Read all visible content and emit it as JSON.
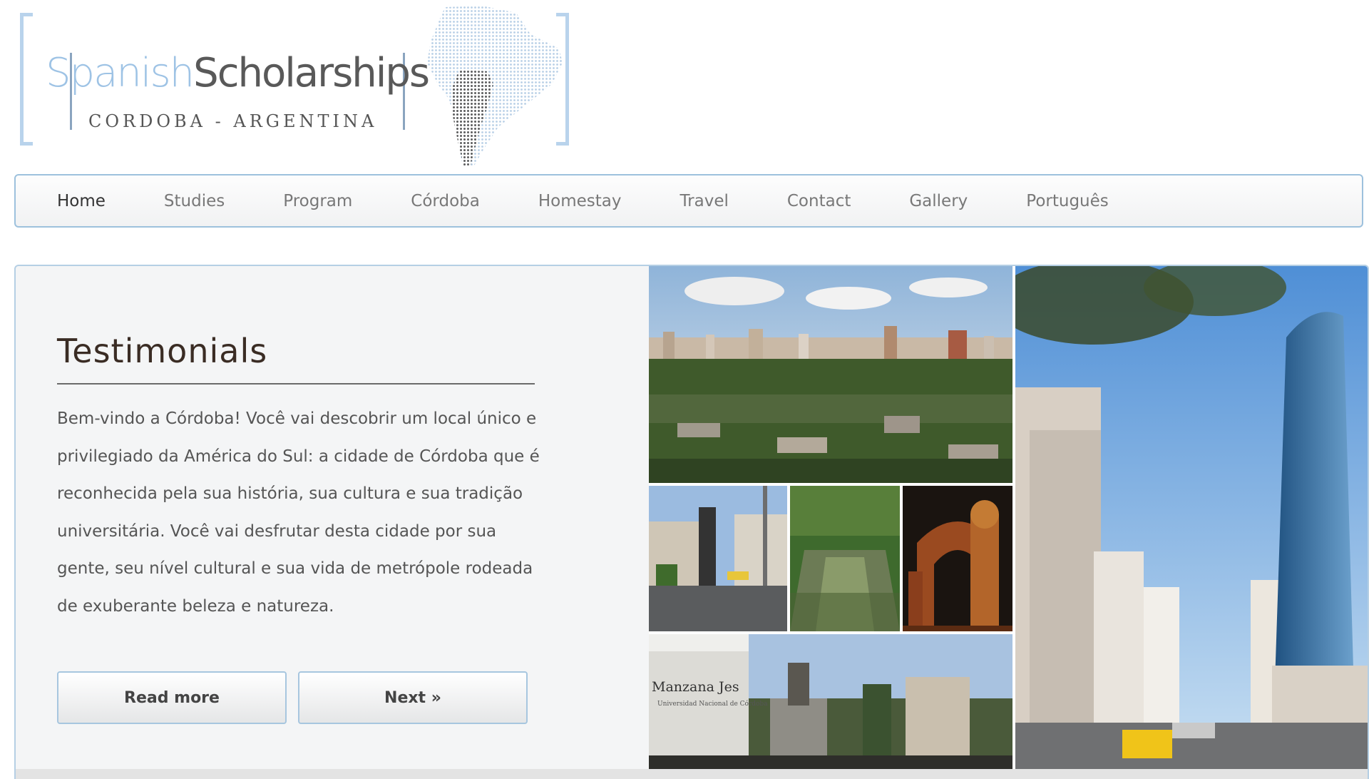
{
  "header": {
    "logo": {
      "title_part1": "Spanish",
      "title_part2": "Scholarships",
      "subtitle": "CORDOBA - ARGENTINA",
      "icon": "south-america-map"
    }
  },
  "nav": {
    "items": [
      {
        "label": "Home",
        "active": true
      },
      {
        "label": "Studies"
      },
      {
        "label": "Program"
      },
      {
        "label": "Córdoba"
      },
      {
        "label": "Homestay"
      },
      {
        "label": "Travel"
      },
      {
        "label": "Contact"
      },
      {
        "label": "Gallery"
      },
      {
        "label": "Português"
      }
    ]
  },
  "main": {
    "title": "Testimonials",
    "body": "Bem-vindo a Córdoba! Você vai descobrir um local único e privilegiado da América do Sul: a cidade de Córdoba que é reconhecida pela sua história, sua cultura e sua tradição universitária. Você vai desfrutar desta cidade por sua gente, seu nível cultural e sua vida de metrópole rodeada de exuberante beleza e natureza.",
    "read_more_label": "Read more",
    "next_label": "Next »"
  },
  "collage": {
    "sign_text_1": "Manzana Jes",
    "sign_text_2": "Universidad Nacional de Córdoba"
  },
  "colors": {
    "accent_border": "#9dc1dd",
    "logo_light_blue": "#9ec3e5",
    "logo_gray": "#595959",
    "heading": "#3a2c24"
  }
}
